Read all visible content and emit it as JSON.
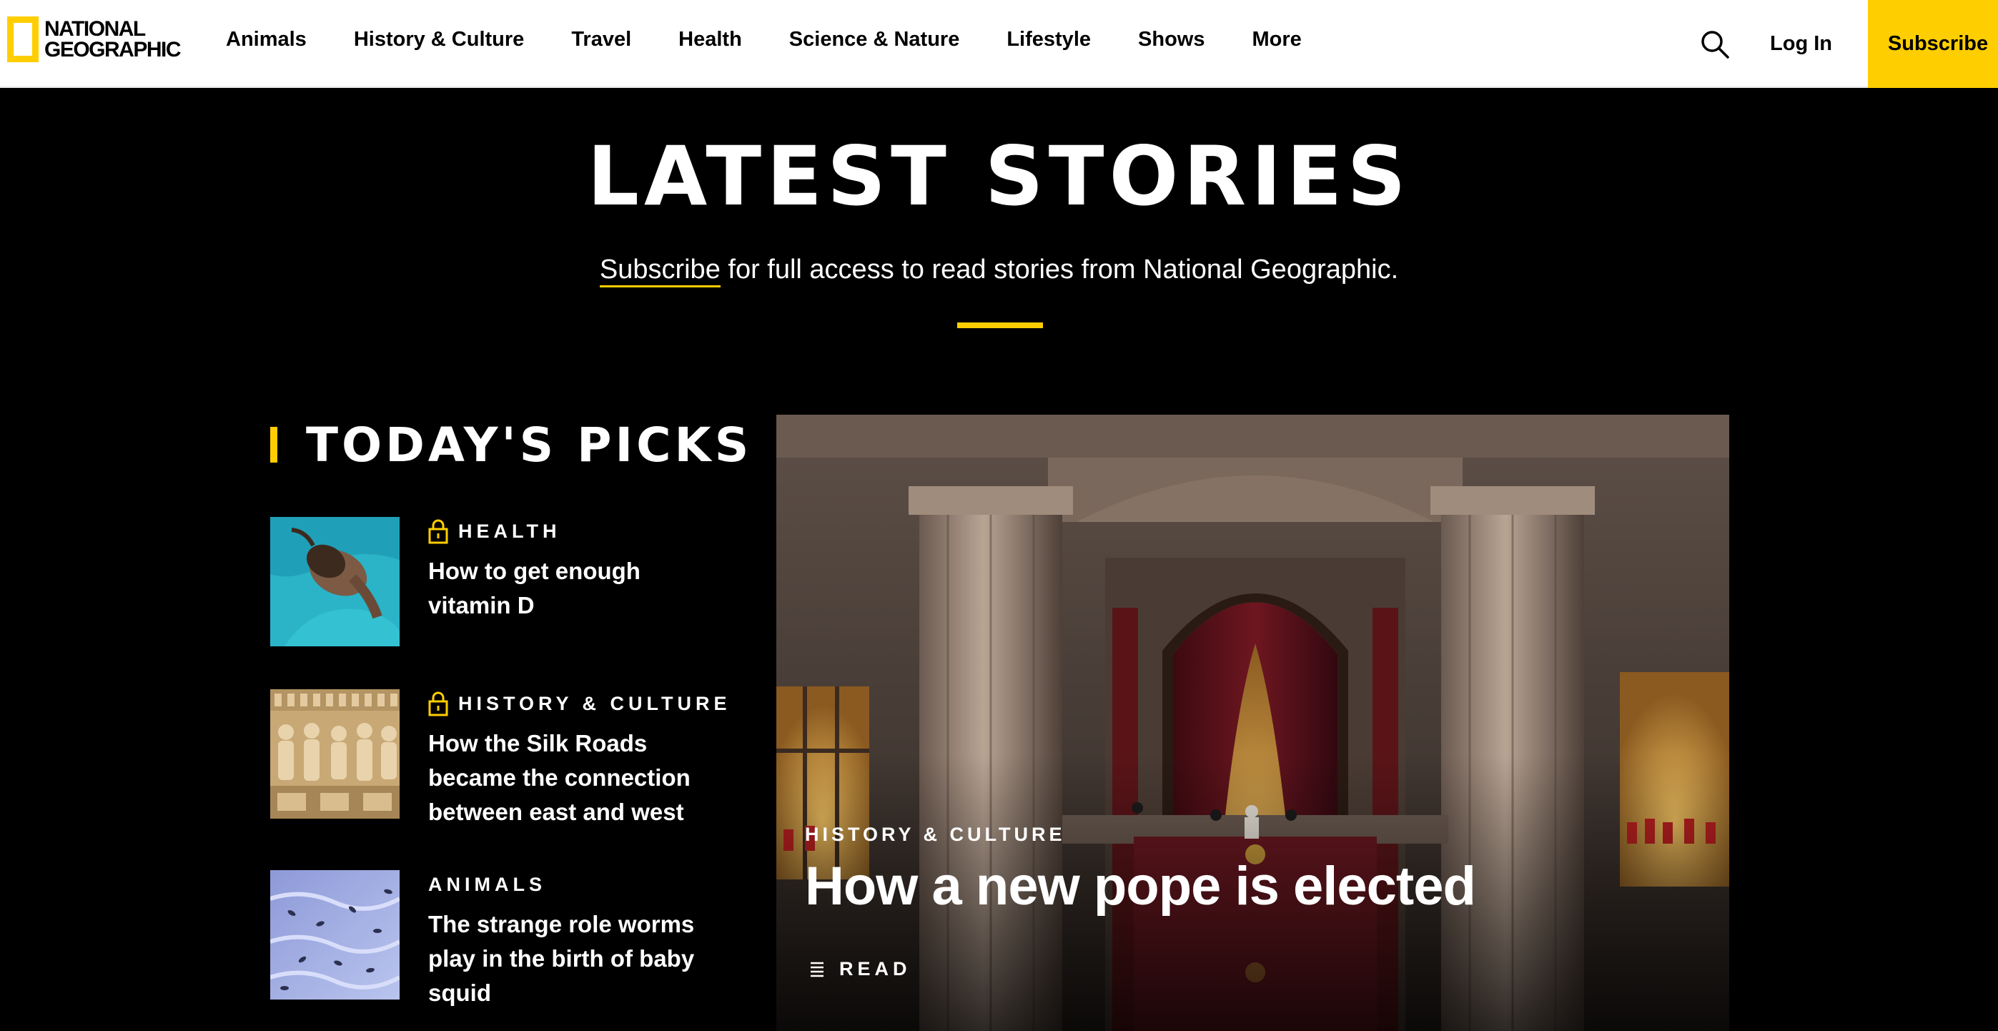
{
  "brand": {
    "line1": "NATIONAL",
    "line2": "GEOGRAPHIC",
    "accent": "#ffce00"
  },
  "nav": {
    "items": [
      "Animals",
      "History & Culture",
      "Travel",
      "Health",
      "Science & Nature",
      "Lifestyle",
      "Shows",
      "More"
    ],
    "search_icon": "search-icon",
    "login_label": "Log In",
    "subscribe_label": "Subscribe"
  },
  "hero": {
    "title": "LATEST STORIES",
    "subscribe_link": "Subscribe",
    "tagline_rest": " for full access to read stories from National Geographic."
  },
  "picks": {
    "heading": "TODAY'S PICKS",
    "items": [
      {
        "category": "HEALTH",
        "locked": true,
        "title": "How to get enough vitamin D",
        "thumb": "woman-in-water"
      },
      {
        "category": "HISTORY & CULTURE",
        "locked": true,
        "title": "How the Silk Roads became the connection between east and west",
        "thumb": "relief-carving"
      },
      {
        "category": "ANIMALS",
        "locked": false,
        "title": "The strange role worms play in the birth of baby squid",
        "thumb": "squid-larvae"
      }
    ]
  },
  "feature": {
    "category": "HISTORY & CULTURE",
    "title": "How a new pope is elected",
    "read_label": "READ",
    "read_icon": "article-lines-icon"
  }
}
